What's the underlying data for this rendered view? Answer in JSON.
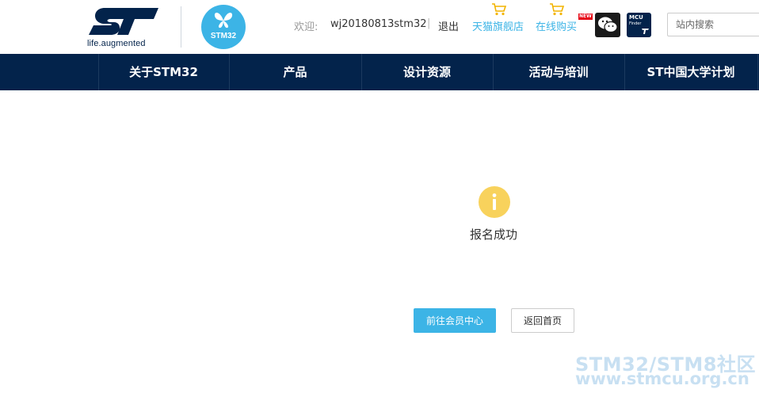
{
  "header": {
    "logo_tagline": "life.augmented",
    "badge_label": "STM32",
    "welcome_label": "欢迎:",
    "username": "wj20180813stm32",
    "separator": "|",
    "logout_label": "退出",
    "tmall_label": "天猫旗舰店",
    "online_buy_label": "在线购买",
    "new_badge": "NEW",
    "mcu_finder_title": "MCU",
    "mcu_finder_sub": "Finder",
    "search_placeholder": "站内搜索"
  },
  "nav": {
    "items": [
      {
        "label": "关于STM32"
      },
      {
        "label": "产品"
      },
      {
        "label": "设计资源"
      },
      {
        "label": "活动与培训"
      },
      {
        "label": "ST中国大学计划"
      }
    ]
  },
  "main": {
    "status_icon": "info-icon",
    "status_glyph": "i",
    "message": "报名成功",
    "primary_button": "前往会员中心",
    "secondary_button": "返回首页"
  },
  "watermark": {
    "line1": "STM32/STM8社区",
    "line2": "www.stmcu.org.cn"
  },
  "colors": {
    "brand_navy": "#03234b",
    "accent_blue": "#3cb4e6",
    "info_yellow": "#f8d25c"
  }
}
